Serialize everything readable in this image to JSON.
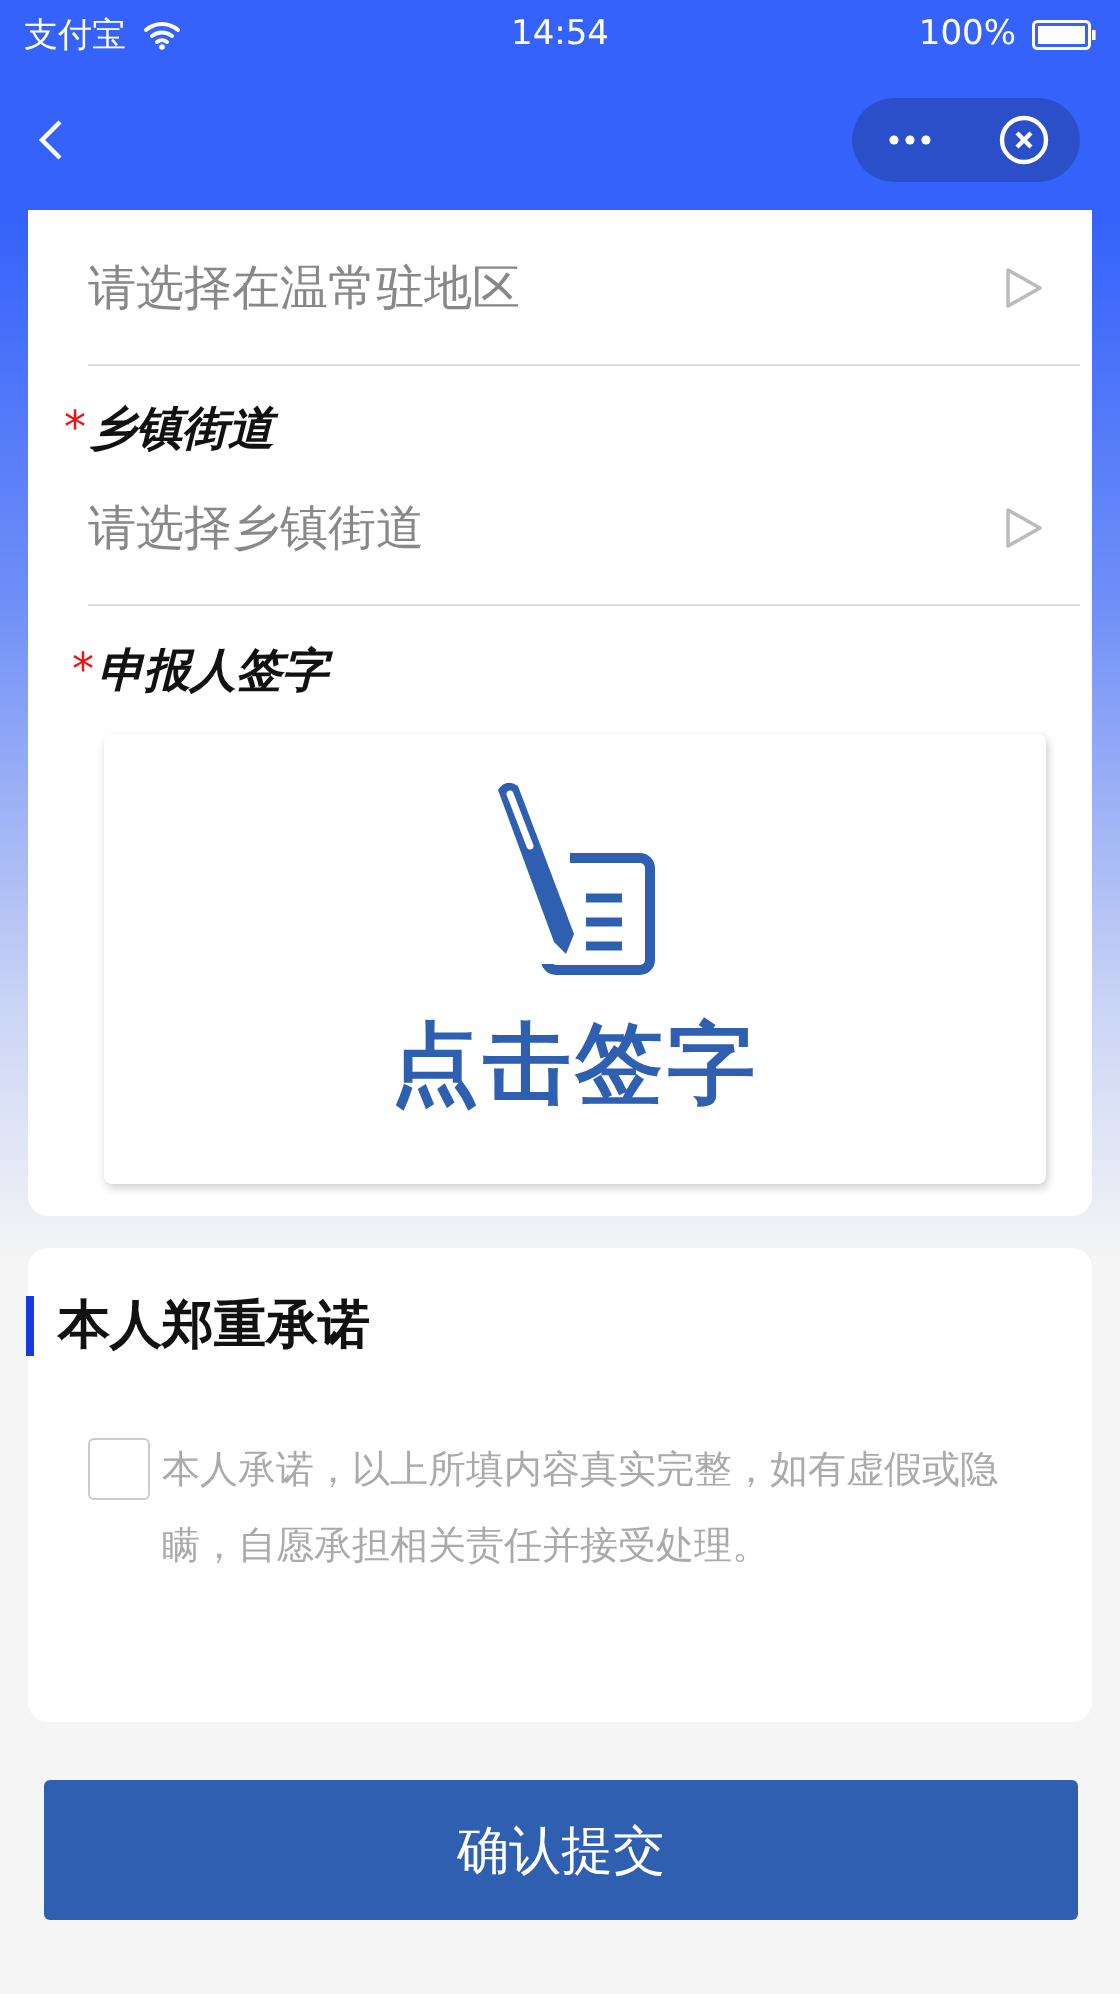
{
  "status_bar": {
    "carrier": "支付宝",
    "time": "14:54",
    "battery": "100%"
  },
  "fields": [
    {
      "placeholder": "请选择在温常驻地区"
    },
    {
      "mark": "*",
      "label": "乡镇街道",
      "placeholder": "请选择乡镇街道"
    }
  ],
  "signature": {
    "mark": "*",
    "label": "申报人签字",
    "button": "点击签字"
  },
  "promise": {
    "title": "本人郑重承诺",
    "checked": false,
    "text": "本人承诺，以上所填内容真实完整，如有虚假或隐瞒，自愿承担相关责任并接受处理。"
  },
  "submit": "确认提交"
}
